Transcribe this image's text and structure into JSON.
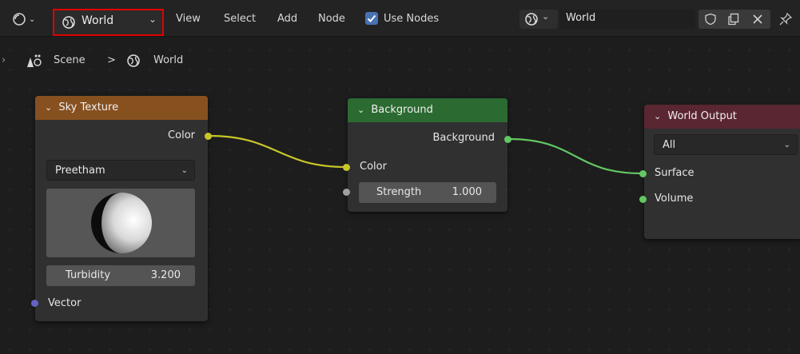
{
  "header": {
    "editor_type_icon": "node-editor-icon",
    "world_dropdown_label": "World",
    "menus": [
      "View",
      "Select",
      "Add",
      "Node"
    ],
    "use_nodes_label": "Use Nodes",
    "use_nodes_checked": true,
    "datablock_name": "World"
  },
  "breadcrumb": {
    "scene": "Scene",
    "separator": ">",
    "world": "World"
  },
  "nodes": {
    "sky_texture": {
      "title": "Sky Texture",
      "output_color": "Color",
      "sky_type": "Preetham",
      "turbidity_label": "Turbidity",
      "turbidity_value": "3.200",
      "input_vector": "Vector",
      "header_color": "#87501f"
    },
    "background": {
      "title": "Background",
      "output_background": "Background",
      "input_color": "Color",
      "strength_label": "Strength",
      "strength_value": "1.000",
      "header_color": "#2b6a30"
    },
    "world_output": {
      "title": "World Output",
      "target": "All",
      "input_surface": "Surface",
      "input_volume": "Volume",
      "header_color": "#5a2631"
    }
  },
  "colors": {
    "link_yellow": "#c7c729",
    "link_green": "#63c763",
    "highlight": "#e00000",
    "checkbox": "#4772b3"
  }
}
